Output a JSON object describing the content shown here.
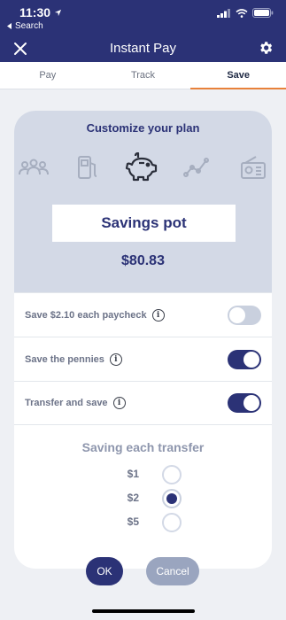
{
  "status": {
    "time": "11:30",
    "back_label": "Search"
  },
  "header": {
    "title": "Instant Pay"
  },
  "tabs": [
    {
      "label": "Pay",
      "active": false
    },
    {
      "label": "Track",
      "active": false
    },
    {
      "label": "Save",
      "active": true
    }
  ],
  "card": {
    "title": "Customize your plan",
    "plan_icons": [
      "people-icon",
      "fuel-pump-icon",
      "piggy-bank-icon",
      "trend-line-icon",
      "radio-icon"
    ],
    "selected_plan_icon": "piggy-bank-icon",
    "pot_name": "Savings pot",
    "pot_amount": "$80.83"
  },
  "options": [
    {
      "label": "Save $2.10 each paycheck",
      "on": false
    },
    {
      "label": "Save the pennies",
      "on": true
    },
    {
      "label": "Transfer and save",
      "on": true
    }
  ],
  "saving": {
    "title": "Saving each transfer",
    "choices": [
      {
        "label": "$1",
        "selected": false
      },
      {
        "label": "$2",
        "selected": true
      },
      {
        "label": "$5",
        "selected": false
      }
    ]
  },
  "buttons": {
    "ok": "OK",
    "cancel": "Cancel"
  },
  "colors": {
    "navy": "#2b3276",
    "accent_orange": "#e8813a",
    "panel": "#d3d9e6"
  }
}
